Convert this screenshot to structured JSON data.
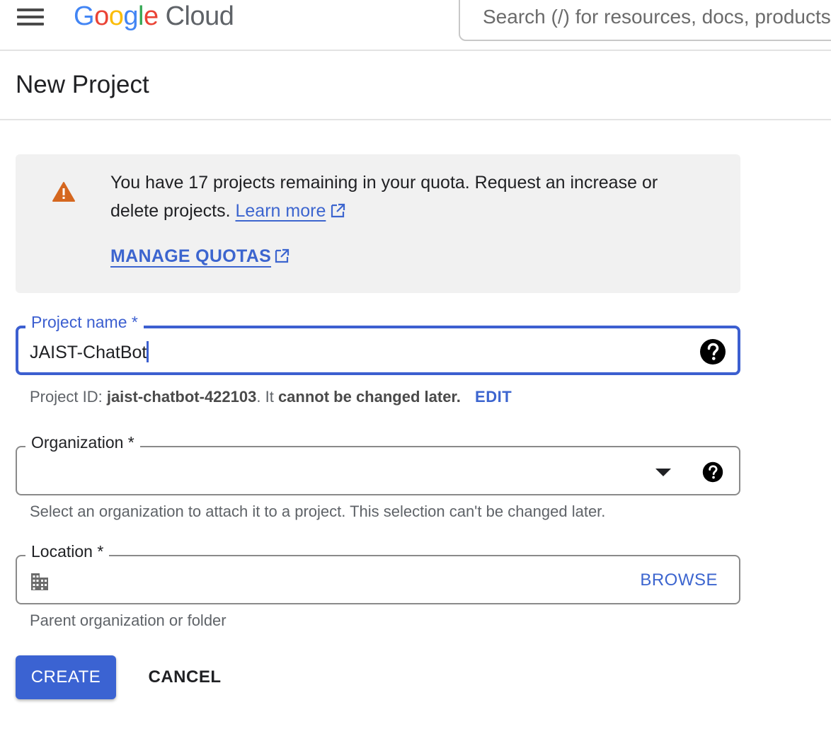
{
  "header": {
    "logo_letters": [
      "G",
      "o",
      "o",
      "g",
      "l",
      "e"
    ],
    "logo_cloud": "Cloud",
    "search_placeholder": "Search (/) for resources, docs, products, and more"
  },
  "page": {
    "title": "New Project"
  },
  "notice": {
    "text": "You have 17 projects remaining in your quota. Request an increase or delete projects.",
    "learn_more": "Learn more",
    "manage_quotas": "MANAGE QUOTAS"
  },
  "project_name": {
    "label": "Project name *",
    "value": "JAIST-ChatBot"
  },
  "project_id": {
    "prefix": "Project ID:",
    "id": "jaist-chatbot-422103",
    "middle": ". It",
    "warning": "cannot be changed later.",
    "edit": "EDIT"
  },
  "organization": {
    "label": "Organization *",
    "value": "",
    "hint": "Select an organization to attach it to a project. This selection can't be changed later."
  },
  "location": {
    "label": "Location *",
    "browse": "BROWSE",
    "hint": "Parent organization or folder"
  },
  "actions": {
    "create": "CREATE",
    "cancel": "CANCEL"
  },
  "colors": {
    "accent": "#3b63d2",
    "link": "#3c65cf",
    "warning": "#e37400"
  }
}
